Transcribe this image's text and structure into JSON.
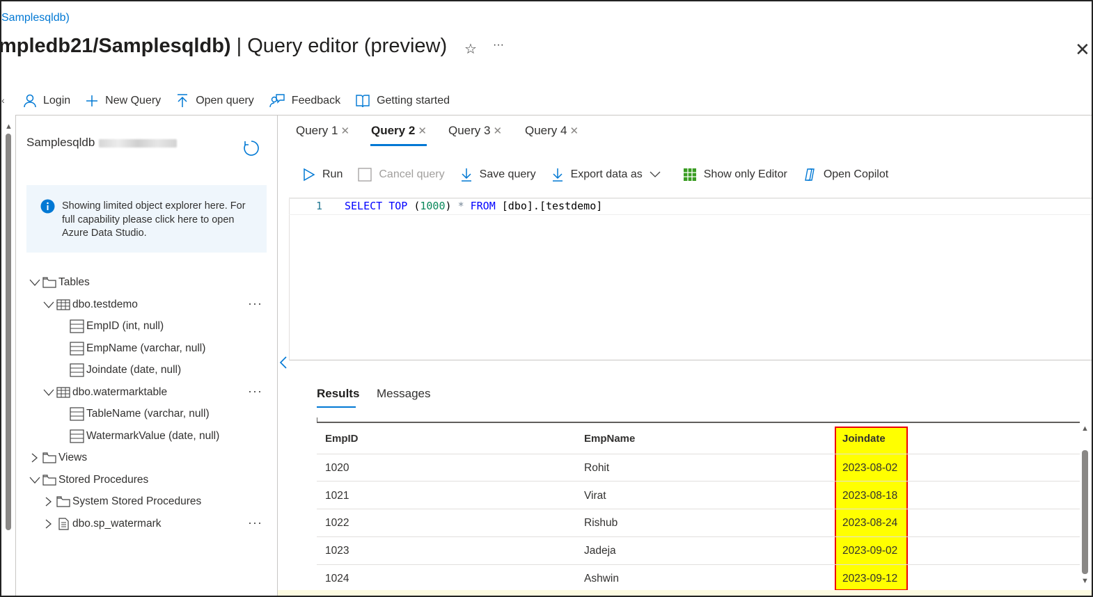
{
  "breadcrumb": "Samplesqldb)",
  "title": {
    "resource": "mpledb21/Samplesqldb)",
    "separator": "|",
    "page": "Query editor (preview)"
  },
  "toolbar": {
    "login": "Login",
    "new_query": "New Query",
    "open_query": "Open query",
    "feedback": "Feedback",
    "getting_started": "Getting started"
  },
  "explorer": {
    "db_name": "Samplesqldb",
    "info_text": "Showing limited object explorer here. For full capability please click here to open Azure Data Studio.",
    "tables_label": "Tables",
    "table1": "dbo.testdemo",
    "table1_cols": [
      "EmpID (int, null)",
      "EmpName (varchar, null)",
      "Joindate (date, null)"
    ],
    "table2": "dbo.watermarktable",
    "table2_cols": [
      "TableName (varchar, null)",
      "WatermarkValue (date, null)"
    ],
    "views_label": "Views",
    "sp_label": "Stored Procedures",
    "system_sp": "System Stored Procedures",
    "sp1": "dbo.sp_watermark",
    "more": "···"
  },
  "tabs": [
    "Query 1",
    "Query 2",
    "Query 3",
    "Query 4"
  ],
  "active_tab": "Query 2",
  "commands": {
    "run": "Run",
    "cancel": "Cancel query",
    "save": "Save query",
    "export": "Export data as",
    "show_editor": "Show only Editor",
    "copilot": "Open Copilot"
  },
  "editor": {
    "line_number": "1",
    "kw1": "SELECT",
    "kw2": "TOP",
    "open_paren": "(",
    "num": "1000",
    "close_paren": ")",
    "star": "*",
    "kw3": "FROM",
    "rest": "[dbo].[testdemo]"
  },
  "results": {
    "tab_results": "Results",
    "tab_messages": "Messages",
    "columns": [
      "EmpID",
      "EmpName",
      "Joindate"
    ],
    "rows": [
      [
        "1020",
        "Rohit",
        "2023-08-02"
      ],
      [
        "1021",
        "Virat",
        "2023-08-18"
      ],
      [
        "1022",
        "Rishub",
        "2023-08-24"
      ],
      [
        "1023",
        "Jadeja",
        "2023-09-02"
      ],
      [
        "1024",
        "Ashwin",
        "2023-09-12"
      ]
    ]
  },
  "colors": {
    "accent": "#0078d4",
    "highlight": "#ffff00",
    "highlight_border": "#e00000"
  }
}
